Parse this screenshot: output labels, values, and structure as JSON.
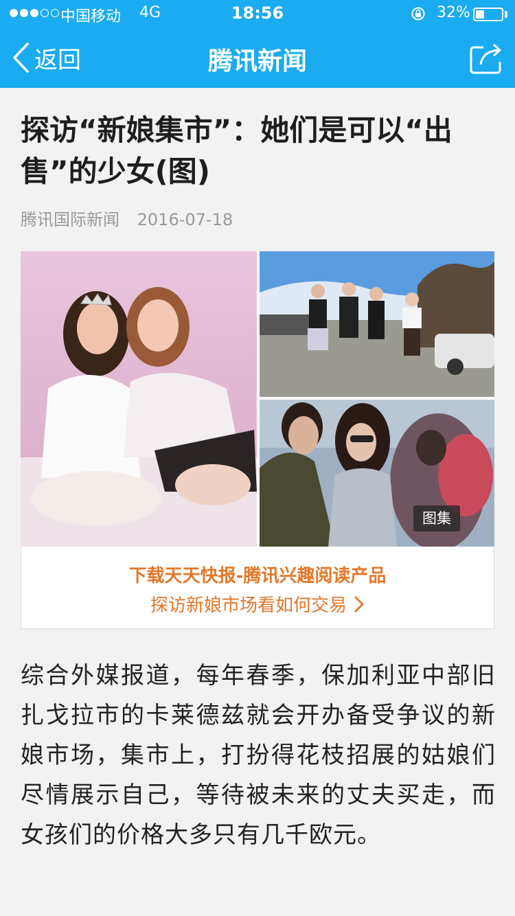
{
  "status_bar": {
    "carrier": "中国移动",
    "network": "4G",
    "time": "18:56",
    "battery_text": "32%",
    "battery_level": 0.32,
    "signal_bars_filled": 3,
    "signal_bars_total": 5,
    "icons": [
      "signal-dots-icon",
      "rotation-lock-icon",
      "battery-icon"
    ]
  },
  "nav": {
    "back_label": "返回",
    "title": "腾讯新闻",
    "share_icon": "share-icon",
    "back_icon": "chevron-left-icon"
  },
  "article": {
    "headline": "探访“新娘集市”：她们是可以“出售”的少女(图)",
    "source": "腾讯国际新闻",
    "date": "2016-07-18",
    "gallery_badge": "图集",
    "promo_line1": "下载天天快报-腾讯兴趣阅读产品",
    "promo_line2": "探访新娘市场看如何交易",
    "body": "综合外媒报道，每年春季，保加利亚中部旧扎戈拉市的卡莱德兹就会开办备受争议的新娘市场，集市上，打扮得花枝招展的姑娘们尽情展示自己，等待被未来的丈夫买走，而女孩们的价格大多只有几千欧元。"
  },
  "colors": {
    "nav_bg": "#1aabf0",
    "promo_text": "#e2782a",
    "meta_text": "#999999",
    "page_bg": "#f2f2f2"
  }
}
